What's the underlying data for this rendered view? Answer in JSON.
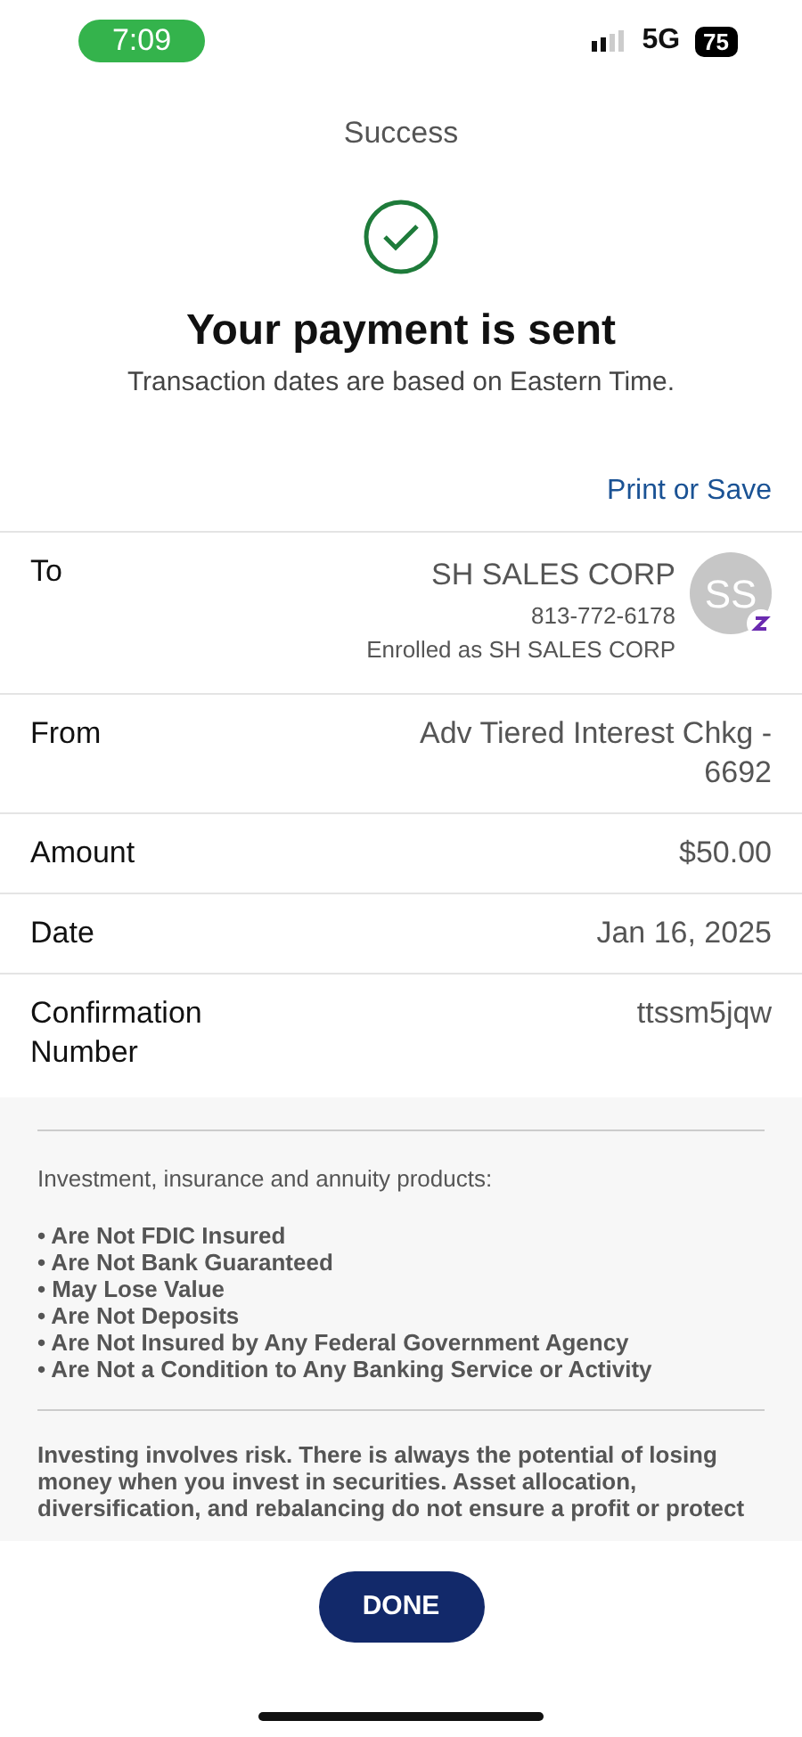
{
  "status_bar": {
    "time": "7:09",
    "network": "5G",
    "battery": "75"
  },
  "header": {
    "title": "Success"
  },
  "result": {
    "heading": "Your payment is sent",
    "note": "Transaction dates are based on Eastern Time."
  },
  "print_link": "Print or Save",
  "details": [
    {
      "kind": "payee",
      "label": "To",
      "name": "SH SALES CORP",
      "phone": "813-772-6178",
      "enrolled": "Enrolled as SH SALES CORP",
      "initials": "SS"
    },
    {
      "kind": "plain",
      "label": "From",
      "value": "Adv Tiered Interest Chkg - 6692"
    },
    {
      "kind": "plain",
      "label": "Amount",
      "value": "$50.00"
    },
    {
      "kind": "plain",
      "label": "Date",
      "value": "Jan 16, 2025"
    },
    {
      "kind": "plain",
      "label": "Confirmation Number",
      "value": "ttssm5jqw"
    }
  ],
  "disclosure": {
    "intro": "Investment, insurance and annuity products:",
    "items": [
      "• Are Not FDIC Insured",
      "• Are Not Bank Guaranteed",
      "• May Lose Value",
      "• Are Not Deposits",
      "• Are Not Insured by Any Federal Government Agency",
      "• Are Not a Condition to Any Banking Service or Activity"
    ],
    "risk": "Investing involves risk. There is always the potential of losing money when you invest in securities. Asset allocation, diversification, and rebalancing do not ensure a profit or protect"
  },
  "done_button": "DONE"
}
